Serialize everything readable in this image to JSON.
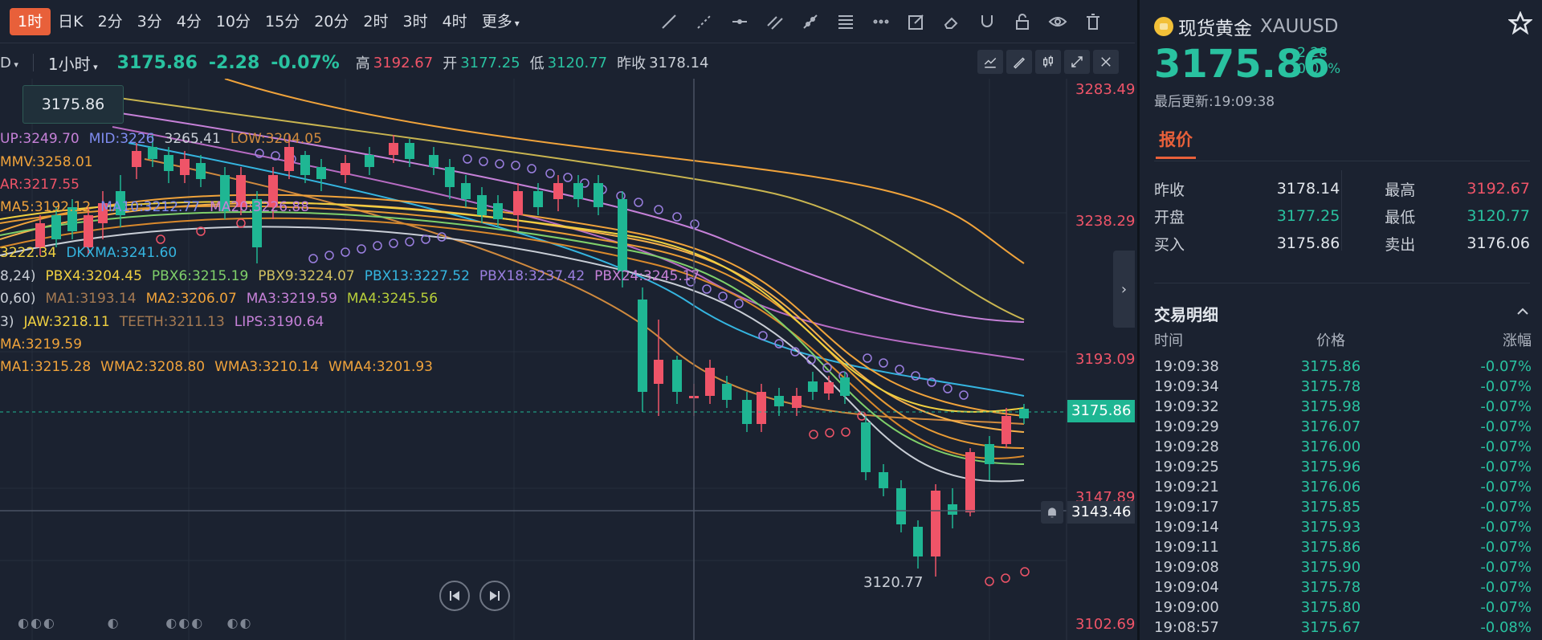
{
  "toolbar": {
    "timeframes": [
      "1时",
      "日K",
      "2分",
      "3分",
      "4分",
      "10分",
      "15分",
      "20分",
      "2时",
      "3时",
      "4时"
    ],
    "active_timeframe": "1时",
    "more_label": "更多",
    "tool_icons": [
      "trend-line-icon",
      "ray-icon",
      "horizontal-line-icon",
      "parallel-channel-icon",
      "segment-icon",
      "fibonacci-icon",
      "more-tools-icon",
      "edit-icon",
      "eraser-icon",
      "magnet-icon",
      "unlock-icon",
      "eye-icon",
      "trash-icon"
    ]
  },
  "info": {
    "symbol_tail": "D",
    "interval": "1小时",
    "price": "3175.86",
    "change": "-2.28",
    "change_pct": "-0.07%",
    "high_label": "高",
    "high": "3192.67",
    "open_label": "开",
    "open": "3177.25",
    "low_label": "低",
    "low": "3120.77",
    "prev_label": "昨收",
    "prev": "3178.14"
  },
  "crosshair_price": "3175.86",
  "legend": {
    "line1": [
      "UP:3249.70",
      "MID:3226",
      "3265.41",
      "LOW:3204.05"
    ],
    "line2": [
      "MMV:3258.01"
    ],
    "line3": [
      "AR:3217.55"
    ],
    "line4": [
      "MA5:3192.12",
      "MA10:3212.77",
      "MA20:3226.88"
    ],
    "line5": [
      "3222.34",
      "DKXMA:3241.60"
    ],
    "line6_prefix": "8,24)",
    "line6": [
      "PBX4:3204.45",
      "PBX6:3215.19",
      "PBX9:3224.07",
      "PBX13:3227.52",
      "PBX18:3237.42",
      "PBX24:3245.17"
    ],
    "line7_prefix": "0,60)",
    "line7": [
      "MA1:3193.14",
      "MA2:3206.07",
      "MA3:3219.59",
      "MA4:3245.56"
    ],
    "line8_prefix": "3)",
    "line8": [
      "JAW:3218.11",
      "TEETH:3211.13",
      "LIPS:3190.64"
    ],
    "line9": [
      "MA:3219.59"
    ],
    "line10": [
      "MA1:3215.28",
      "WMA2:3208.80",
      "WMA3:3210.14",
      "WMA4:3201.93"
    ]
  },
  "axis": {
    "labels": [
      "3283.49",
      "3238.29",
      "3193.09",
      "3147.89",
      "3102.69"
    ],
    "current_tag": "3175.86",
    "cross_tag": "3143.46"
  },
  "low_marker": "3120.77",
  "panel": {
    "name": "现货黄金",
    "code": "XAUUSD",
    "price": "3175.86",
    "change": "-2.28",
    "change_pct": "-0.07%",
    "updated": "最后更新:19:09:38",
    "tab": "报价",
    "quote": {
      "prev_label": "昨收",
      "prev": "3178.14",
      "high_label": "最高",
      "high": "3192.67",
      "open_label": "开盘",
      "open": "3177.25",
      "low_label": "最低",
      "low": "3120.77",
      "bid_label": "买入",
      "bid": "3175.86",
      "ask_label": "卖出",
      "ask": "3176.06"
    },
    "trades_title": "交易明细",
    "trades_head": [
      "时间",
      "价格",
      "涨幅"
    ],
    "trades": [
      [
        "19:09:38",
        "3175.86",
        "-0.07%"
      ],
      [
        "19:09:34",
        "3175.78",
        "-0.07%"
      ],
      [
        "19:09:32",
        "3175.98",
        "-0.07%"
      ],
      [
        "19:09:29",
        "3176.07",
        "-0.07%"
      ],
      [
        "19:09:28",
        "3176.00",
        "-0.07%"
      ],
      [
        "19:09:25",
        "3175.96",
        "-0.07%"
      ],
      [
        "19:09:21",
        "3176.06",
        "-0.07%"
      ],
      [
        "19:09:17",
        "3175.85",
        "-0.07%"
      ],
      [
        "19:09:14",
        "3175.93",
        "-0.07%"
      ],
      [
        "19:09:11",
        "3175.86",
        "-0.07%"
      ],
      [
        "19:09:08",
        "3175.90",
        "-0.07%"
      ],
      [
        "19:09:04",
        "3175.78",
        "-0.07%"
      ],
      [
        "19:09:00",
        "3175.80",
        "-0.07%"
      ],
      [
        "19:08:57",
        "3175.67",
        "-0.08%"
      ]
    ]
  },
  "colors": {
    "up": "#ef5468",
    "down": "#1fb693",
    "accent": "#e8603a",
    "bg": "#1b2230"
  }
}
